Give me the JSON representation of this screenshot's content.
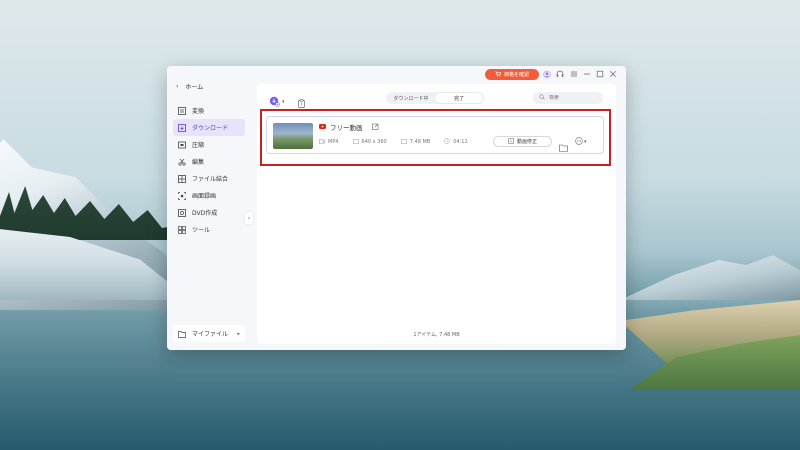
{
  "app": {
    "back_label": "ホーム",
    "buy_label": "価格を確認",
    "nav": [
      {
        "name": "convert",
        "label": "変換"
      },
      {
        "name": "download",
        "label": "ダウンロード"
      },
      {
        "name": "compress",
        "label": "圧縮"
      },
      {
        "name": "edit",
        "label": "編集"
      },
      {
        "name": "merge",
        "label": "ファイル結合"
      },
      {
        "name": "screen-record",
        "label": "画面録画"
      },
      {
        "name": "dvd",
        "label": "DVD作成"
      },
      {
        "name": "tools",
        "label": "ツール"
      }
    ],
    "my_files_label": "マイファイル",
    "tabs": [
      {
        "label": "ダウンロード中",
        "active": false
      },
      {
        "label": "完了",
        "active": true
      }
    ],
    "search_placeholder": "検索",
    "item": {
      "title": "フリー動画",
      "format": "MP4",
      "resolution": "640 x 360",
      "size": "7.48 MB",
      "duration": "04:12",
      "fix_label": "動画修正"
    },
    "footer": "1アイテム, 7.48 MB"
  },
  "colors": {
    "accent": "#5b3cc4",
    "buy": "#f25c3a",
    "highlight": "#cc2020"
  }
}
